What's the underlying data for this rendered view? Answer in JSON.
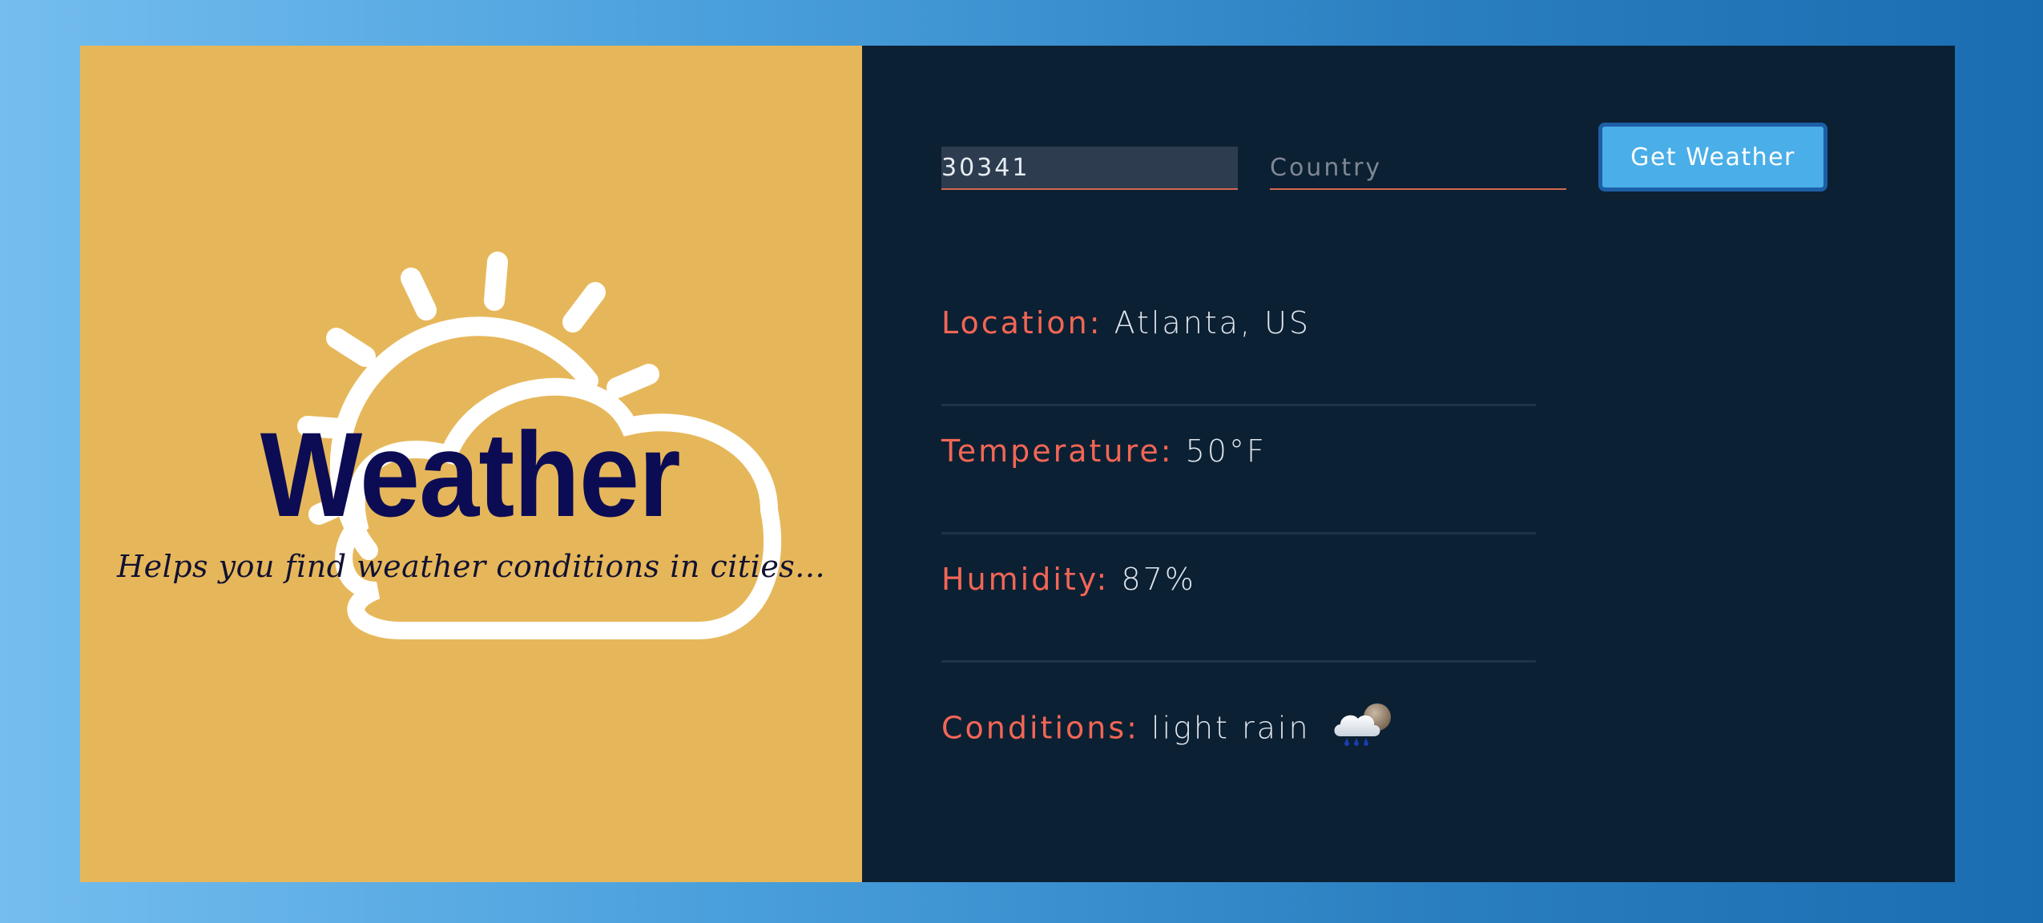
{
  "brand": {
    "title": "Weather",
    "subtitle": "Helps you find weather conditions in cities..."
  },
  "search": {
    "zip_value": "30341",
    "zip_placeholder": "",
    "country_value": "",
    "country_placeholder": "Country",
    "button_label": "Get Weather"
  },
  "results": {
    "location_label": "Location:",
    "location_value": "Atlanta, US",
    "temperature_label": "Temperature:",
    "temperature_value": "50°F",
    "humidity_label": "Humidity:",
    "humidity_value": "87%",
    "conditions_label": "Conditions:",
    "conditions_value": "light rain",
    "conditions_icon": "rain-cloud-sun-icon"
  },
  "colors": {
    "brand_panel": "#e6b75a",
    "data_panel": "#0c2033",
    "title": "#0c0c55",
    "label_accent": "#f26655",
    "button": "#4aaee8",
    "button_border": "#1c5fa6",
    "field_underline": "#d4684f"
  }
}
